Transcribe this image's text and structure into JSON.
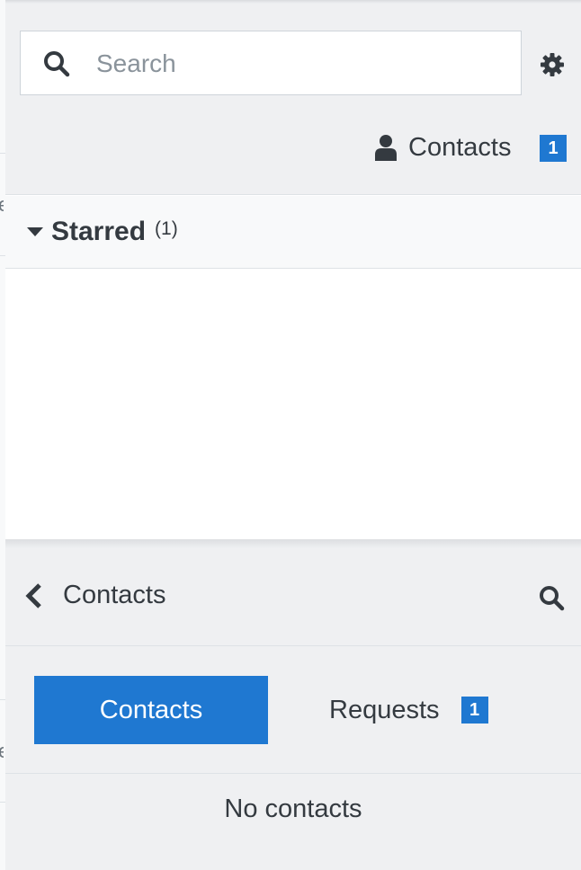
{
  "panel_top": {
    "search": {
      "placeholder": "Search",
      "value": ""
    },
    "settings_icon": "gear-icon",
    "contacts_link": {
      "label": "Contacts",
      "badge": "1"
    },
    "starred": {
      "label": "Starred",
      "count": "(1)"
    }
  },
  "panel_bottom": {
    "header": {
      "title": "Contacts"
    },
    "tabs": [
      {
        "label": "Contacts",
        "active": true
      },
      {
        "label": "Requests",
        "badge": "1",
        "active": false
      }
    ],
    "empty_message": "No contacts"
  },
  "colors": {
    "accent": "#1f78d1",
    "header_bg": "#eff0f2",
    "text": "#343a40",
    "border": "#dee2e6"
  }
}
